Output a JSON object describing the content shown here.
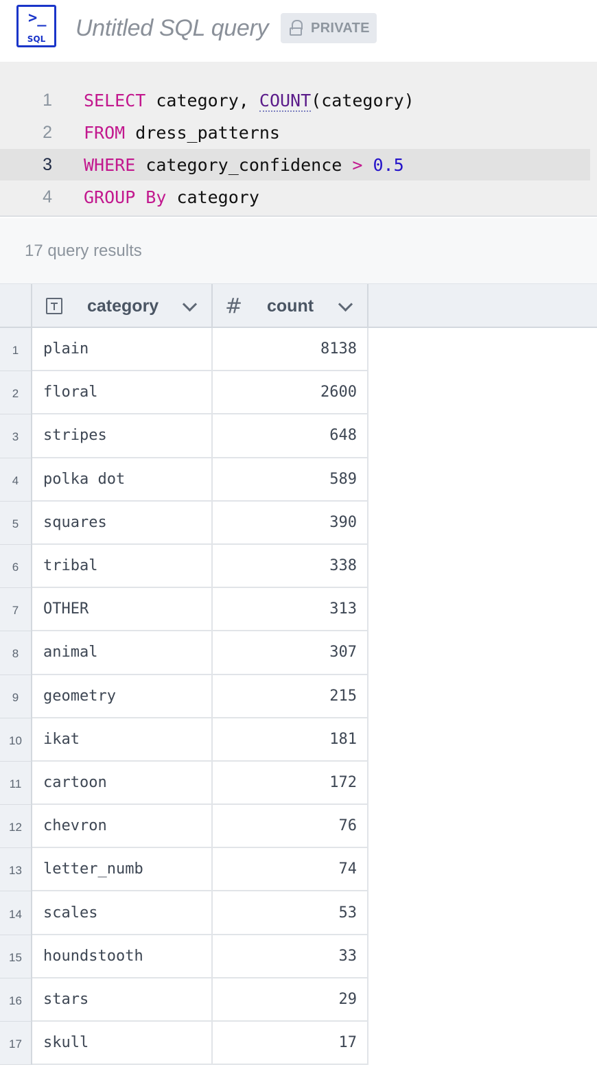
{
  "header": {
    "logo_text": "SQL",
    "logo_glyph": ">_",
    "title": "Untitled SQL query",
    "visibility_badge": "PRIVATE"
  },
  "editor": {
    "active_line": 3,
    "lines": [
      {
        "number": "1",
        "tokens": [
          {
            "t": "SELECT",
            "k": "kw"
          },
          {
            "t": " category, ",
            "k": "plain"
          },
          {
            "t": "COUNT",
            "k": "fn"
          },
          {
            "t": "(category)",
            "k": "plain"
          }
        ]
      },
      {
        "number": "2",
        "tokens": [
          {
            "t": "FROM",
            "k": "kw"
          },
          {
            "t": " dress_patterns",
            "k": "plain"
          }
        ]
      },
      {
        "number": "3",
        "tokens": [
          {
            "t": "WHERE",
            "k": "kw"
          },
          {
            "t": " category_confidence ",
            "k": "plain"
          },
          {
            "t": ">",
            "k": "op"
          },
          {
            "t": " ",
            "k": "plain"
          },
          {
            "t": "0.5",
            "k": "num"
          }
        ]
      },
      {
        "number": "4",
        "tokens": [
          {
            "t": "GROUP By",
            "k": "kw"
          },
          {
            "t": " category",
            "k": "plain"
          }
        ]
      }
    ]
  },
  "results": {
    "summary": "17 query results",
    "columns": [
      {
        "name": "category",
        "type_icon": "text-type-icon"
      },
      {
        "name": "count",
        "type_icon": "hash-type-icon",
        "glyph": "#"
      }
    ],
    "rows": [
      {
        "index": "1",
        "category": "plain",
        "count": "8138"
      },
      {
        "index": "2",
        "category": "floral",
        "count": "2600"
      },
      {
        "index": "3",
        "category": "stripes",
        "count": "648"
      },
      {
        "index": "4",
        "category": "polka dot",
        "count": "589"
      },
      {
        "index": "5",
        "category": "squares",
        "count": "390"
      },
      {
        "index": "6",
        "category": "tribal",
        "count": "338"
      },
      {
        "index": "7",
        "category": "OTHER",
        "count": "313"
      },
      {
        "index": "8",
        "category": "animal",
        "count": "307"
      },
      {
        "index": "9",
        "category": "geometry",
        "count": "215"
      },
      {
        "index": "10",
        "category": "ikat",
        "count": "181"
      },
      {
        "index": "11",
        "category": "cartoon",
        "count": "172"
      },
      {
        "index": "12",
        "category": "chevron",
        "count": "76"
      },
      {
        "index": "13",
        "category": "letter_numb",
        "count": "74"
      },
      {
        "index": "14",
        "category": "scales",
        "count": "53"
      },
      {
        "index": "15",
        "category": "houndstooth",
        "count": "33"
      },
      {
        "index": "16",
        "category": "stars",
        "count": "29"
      },
      {
        "index": "17",
        "category": "skull",
        "count": "17"
      }
    ]
  },
  "colors": {
    "brand": "#1a35c9",
    "keyword": "#c2188e",
    "function": "#5b1c8a",
    "number": "#2413c9"
  }
}
